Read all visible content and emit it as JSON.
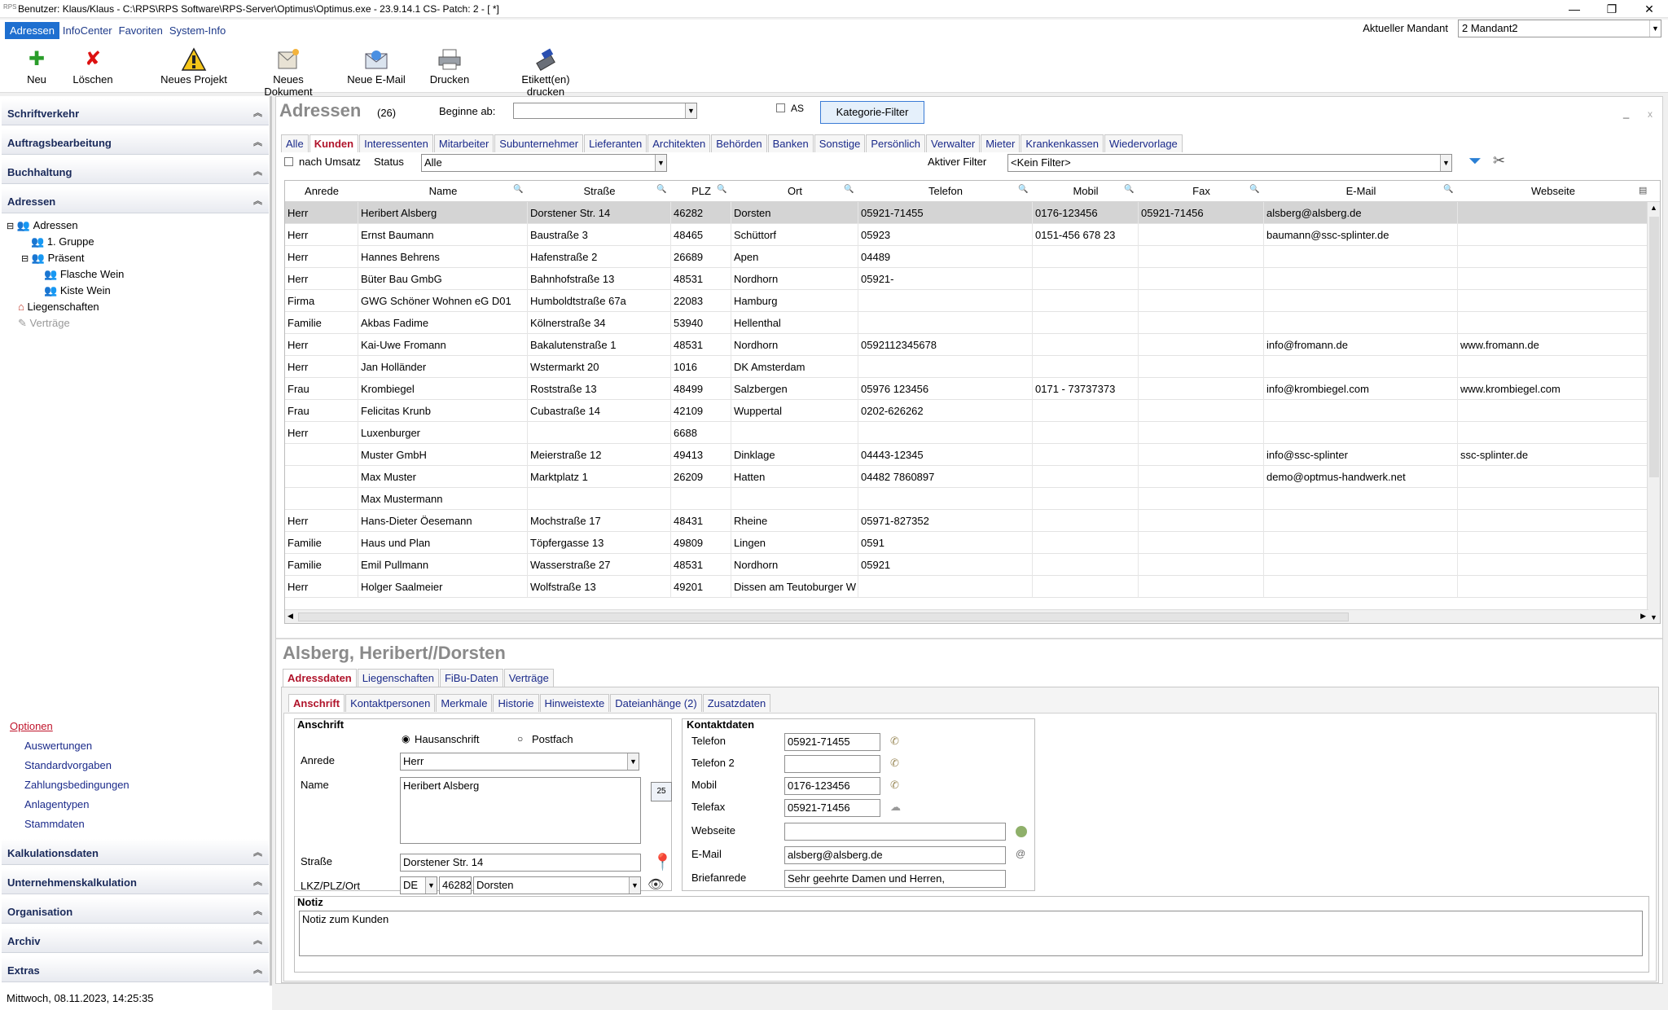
{
  "window": {
    "title": "Benutzer: Klaus/Klaus - C:\\RPS\\RPS Software\\RPS-Server\\Optimus\\Optimus.exe - 23.9.14.1 CS- Patch: 2 - [ *]",
    "app_icon": "RPS",
    "controls": [
      "—",
      "❐",
      "✕"
    ]
  },
  "menubar": {
    "items": [
      "Adressen",
      "InfoCenter",
      "Favoriten",
      "System-Info"
    ],
    "mandant_label": "Aktueller Mandant",
    "mandant_value": "2 Mandant2"
  },
  "toolbar": [
    {
      "label": "Neu",
      "icon": "plus-icon"
    },
    {
      "label": "Löschen",
      "icon": "delete-x-icon"
    },
    {
      "label": "Neues Projekt",
      "icon": "construction-sign-icon"
    },
    {
      "label": "Neues Dokument",
      "icon": "document-icon"
    },
    {
      "label": "Neue E-Mail",
      "icon": "email-icon"
    },
    {
      "label": "Drucken",
      "icon": "printer-icon"
    },
    {
      "label": "Etikett(en) drucken",
      "icon": "label-printer-icon"
    }
  ],
  "leftnav": {
    "sections_top": [
      "Schriftverkehr",
      "Auftragsbearbeitung",
      "Buchhaltung",
      "Adressen"
    ],
    "tree": [
      {
        "label": "Adressen",
        "level": 0,
        "expander": "⊟"
      },
      {
        "label": "1. Gruppe",
        "level": 1,
        "expander": ""
      },
      {
        "label": "Präsent",
        "level": 1,
        "expander": "⊟"
      },
      {
        "label": "Flasche Wein",
        "level": 2,
        "expander": ""
      },
      {
        "label": "Kiste Wein",
        "level": 2,
        "expander": ""
      },
      {
        "label": "Liegenschaften",
        "level": 0,
        "expander": ""
      },
      {
        "label": "Verträge",
        "level": 0,
        "expander": ""
      }
    ],
    "options_title": "Optionen",
    "options": [
      "Auswertungen",
      "Standardvorgaben",
      "Zahlungsbedingungen",
      "Anlagentypen",
      "Stammdaten"
    ],
    "sections_bottom": [
      "Kalkulationsdaten",
      "Unternehmenskalkulation",
      "Organisation",
      "Archiv",
      "Extras"
    ],
    "status": "Mittwoch, 08.11.2023, 14:25:35"
  },
  "main": {
    "title": "Adressen",
    "count": "(26)",
    "beginne_label": "Beginne ab:",
    "beginne_value": "",
    "as_label": "AS",
    "kategorie_button": "Kategorie-Filter",
    "window_min": "_",
    "window_close": "x",
    "tabs": [
      "Alle",
      "Kunden",
      "Interessenten",
      "Mitarbeiter",
      "Subunternehmer",
      "Lieferanten",
      "Architekten",
      "Behörden",
      "Banken",
      "Sonstige",
      "Persönlich",
      "Verwalter",
      "Mieter",
      "Krankenkassen",
      "Wiedervorlage"
    ],
    "active_tab": "Kunden",
    "nach_umsatz_label": "nach Umsatz",
    "status_label": "Status",
    "status_value": "Alle",
    "aktiver_filter_label": "Aktiver Filter",
    "aktiver_filter_value": "<Kein Filter>"
  },
  "grid": {
    "columns": [
      "Anrede",
      "Name",
      "Straße",
      "PLZ",
      "Ort",
      "Telefon",
      "Mobil",
      "Fax",
      "E-Mail",
      "Webseite"
    ],
    "rows": [
      [
        "Herr",
        "Heribert Alsberg",
        "Dorstener Str. 14",
        "46282",
        "Dorsten",
        "05921-71455",
        "0176-123456",
        "05921-71456",
        "alsberg@alsberg.de",
        ""
      ],
      [
        "Herr",
        "Ernst Baumann",
        "Baustraße 3",
        "48465",
        "Schüttorf",
        "05923",
        "0151-456 678 23",
        "",
        "baumann@ssc-splinter.de",
        ""
      ],
      [
        "Herr",
        "Hannes Behrens",
        "Hafenstraße 2",
        "26689",
        "Apen",
        "04489",
        "",
        "",
        "",
        ""
      ],
      [
        "Herr",
        "Büter Bau GmbG",
        "Bahnhofstraße 13",
        "48531",
        "Nordhorn",
        "05921-",
        "",
        "",
        "",
        ""
      ],
      [
        "Firma",
        "GWG Schöner Wohnen eG D01",
        "Humboldtstraße 67a",
        "22083",
        "Hamburg",
        "",
        "",
        "",
        "",
        ""
      ],
      [
        "Familie",
        "Akbas Fadime",
        "Kölnerstraße 34",
        "53940",
        "Hellenthal",
        "",
        "",
        "",
        "",
        ""
      ],
      [
        "Herr",
        "Kai-Uwe Fromann",
        "Bakalutenstraße 1",
        "48531",
        "Nordhorn",
        "0592112345678",
        "",
        "",
        "info@fromann.de",
        "www.fromann.de"
      ],
      [
        "Herr",
        "Jan Holländer",
        "Wstermarkt 20",
        "1016",
        "DK Amsterdam",
        "",
        "",
        "",
        "",
        ""
      ],
      [
        "Frau",
        "Krombiegel",
        "Roststraße 13",
        "48499",
        "Salzbergen",
        "05976 123456",
        "0171 - 73737373",
        "",
        "info@krombiegel.com",
        "www.krombiegel.com"
      ],
      [
        "Frau",
        "Felicitas Krunb",
        "Cubastraße 14",
        "42109",
        "Wuppertal",
        "0202-626262",
        "",
        "",
        "",
        ""
      ],
      [
        "Herr",
        "Luxenburger",
        "",
        "6688",
        "",
        "",
        "",
        "",
        "",
        ""
      ],
      [
        "",
        "Muster GmbH",
        "Meierstraße 12",
        "49413",
        "Dinklage",
        "04443-12345",
        "",
        "",
        "info@ssc-splinter",
        "ssc-splinter.de"
      ],
      [
        "",
        "Max Muster",
        "Marktplatz 1",
        "26209",
        "Hatten",
        "04482 7860897",
        "",
        "",
        "demo@optmus-handwerk.net",
        ""
      ],
      [
        "",
        "Max Mustermann",
        "",
        "",
        "",
        "",
        "",
        "",
        "",
        ""
      ],
      [
        "Herr",
        "Hans-Dieter Öesemann",
        "Mochstraße 17",
        "48431",
        "Rheine",
        "05971-827352",
        "",
        "",
        "",
        ""
      ],
      [
        "Familie",
        "Haus und Plan",
        "Töpfergasse 13",
        "49809",
        "Lingen",
        "0591",
        "",
        "",
        "",
        ""
      ],
      [
        "Familie",
        "Emil Pullmann",
        "Wasserstraße 27",
        "48531",
        "Nordhorn",
        "05921",
        "",
        "",
        "",
        ""
      ],
      [
        "Herr",
        "Holger Saalmeier",
        "Wolfstraße 13",
        "49201",
        "Dissen am Teutoburger W",
        "",
        "",
        "",
        "",
        ""
      ]
    ]
  },
  "detail": {
    "title": "Alsberg, Heribert//Dorsten",
    "tabs": [
      "Adressdaten",
      "Liegenschaften",
      "FiBu-Daten",
      "Verträge"
    ],
    "subtabs": [
      "Anschrift",
      "Kontaktpersonen",
      "Merkmale",
      "Historie",
      "Hinweistexte",
      "Dateianhänge (2)",
      "Zusatzdaten"
    ],
    "anschrift": {
      "title": "Anschrift",
      "radio1": "Hausanschrift",
      "radio2": "Postfach",
      "anrede_label": "Anrede",
      "anrede_value": "Herr",
      "name_label": "Name",
      "name_value": "Heribert Alsberg",
      "strasse_label": "Straße",
      "strasse_value": "Dorstener Str. 14",
      "lkz_label": "LKZ/PLZ/Ort",
      "lkz_value": "DE",
      "plz_value": "46282",
      "ort_value": "Dorsten",
      "calendar_day": "25"
    },
    "kontakt": {
      "title": "Kontaktdaten",
      "telefon_label": "Telefon",
      "telefon_value": "05921-71455",
      "telefon2_label": "Telefon 2",
      "telefon2_value": "",
      "mobil_label": "Mobil",
      "mobil_value": "0176-123456",
      "telefax_label": "Telefax",
      "telefax_value": "05921-71456",
      "webseite_label": "Webseite",
      "webseite_value": "",
      "email_label": "E-Mail",
      "email_value": "alsberg@alsberg.de",
      "briefanrede_label": "Briefanrede",
      "briefanrede_value": "Sehr geehrte Damen und Herren,"
    },
    "notiz": {
      "title": "Notiz",
      "value": "Notiz zum Kunden"
    }
  }
}
